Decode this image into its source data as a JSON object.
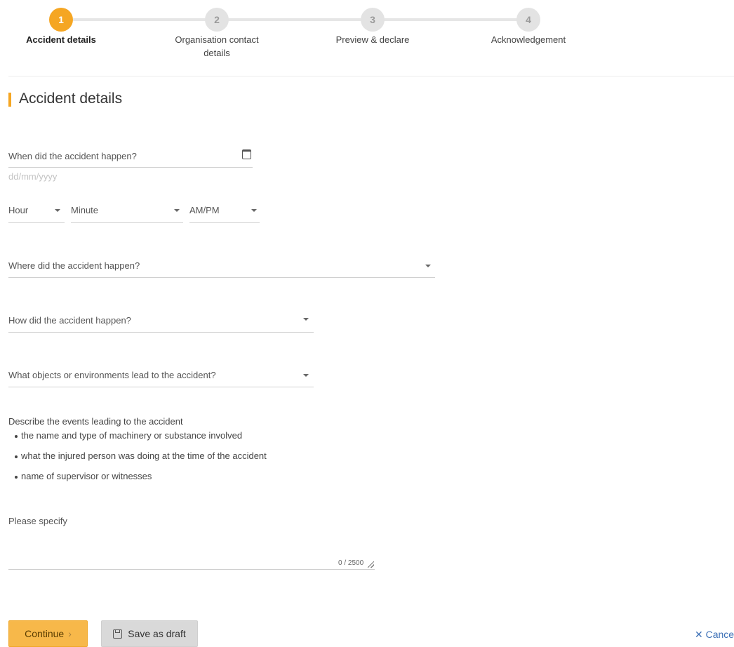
{
  "stepper": {
    "steps": [
      {
        "number": "1",
        "label": "Accident details"
      },
      {
        "number": "2",
        "label_line1": "Organisation contact",
        "label_line2": "details"
      },
      {
        "number": "3",
        "label": "Preview & declare"
      },
      {
        "number": "4",
        "label": "Acknowledgement"
      }
    ],
    "active_index": 0
  },
  "section": {
    "title": "Accident details"
  },
  "date_field": {
    "label": "When did the accident happen?",
    "placeholder": "dd/mm/yyyy",
    "icon": "calendar-icon"
  },
  "time_fields": {
    "hour": "Hour",
    "minute": "Minute",
    "ampm": "AM/PM"
  },
  "where_field": {
    "label": "Where did the accident happen?"
  },
  "how_field": {
    "label": "How did the accident happen?"
  },
  "objects_field": {
    "label": "What objects or environments lead to the accident?"
  },
  "description": {
    "intro": "Describe the events leading to the accident",
    "bullets": [
      "the name and type of machinery or substance involved",
      "what the injured person was doing at the time of the accident",
      "name of supervisor or witnesses"
    ]
  },
  "specify_field": {
    "label": "Please specify",
    "counter": "0 / 2500"
  },
  "actions": {
    "continue_label": "Continue",
    "continue_icon": "chevron-right-icon",
    "draft_label": "Save as draft",
    "draft_icon": "save-icon",
    "cancel_label": "Cance",
    "cancel_icon": "close-icon"
  },
  "colors": {
    "accent": "#f5a623",
    "link": "#3b6fb6"
  }
}
